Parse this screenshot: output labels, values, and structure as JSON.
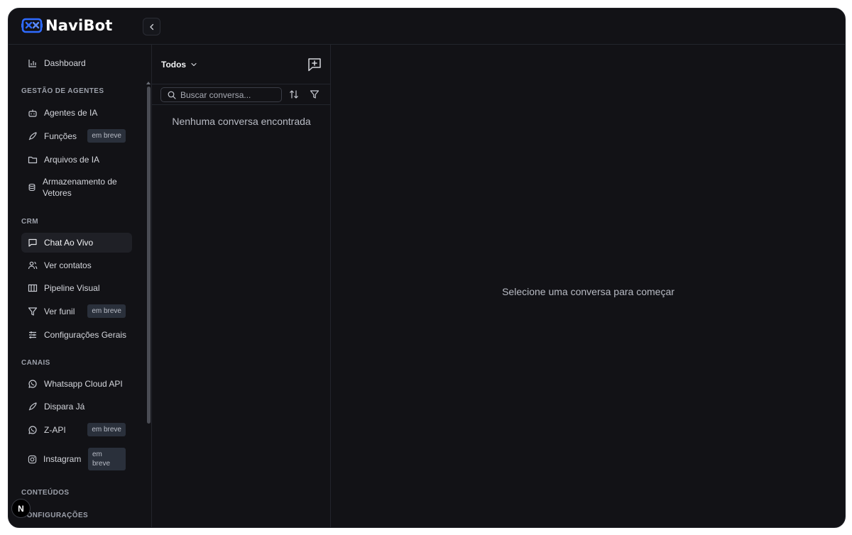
{
  "app": {
    "name": "NaviBot"
  },
  "sidebar": {
    "dashboard": "Dashboard",
    "sections": {
      "agents": "GESTÃO DE AGENTES",
      "crm": "CRM",
      "channels": "CANAIS",
      "contents": "CONTEÚDOS",
      "settings": "CONFIGURAÇÕES"
    },
    "items": {
      "ai_agents": "Agentes de IA",
      "functions": "Funções",
      "ai_files": "Arquivos de IA",
      "vector_storage": "Armazenamento de Vetores",
      "live_chat": "Chat Ao Vivo",
      "contacts": "Ver contatos",
      "pipeline": "Pipeline Visual",
      "funnel": "Ver funil",
      "general_settings": "Configurações Gerais",
      "whatsapp": "Whatsapp Cloud API",
      "dispara": "Dispara Já",
      "zapi": "Z-API",
      "instagram": "Instagram"
    },
    "badge_soon": "em breve",
    "active_item": "Chat Ao Vivo"
  },
  "conversations": {
    "filter_label": "Todos",
    "search_placeholder": "Buscar conversa...",
    "empty_text": "Nenhuma conversa encontrada"
  },
  "main": {
    "empty_text": "Selecione uma conversa para começar"
  },
  "footer": {
    "avatar_letter": "N"
  },
  "colors": {
    "background": "#121216",
    "border": "#23252c",
    "brand_blue": "#2f6bff",
    "badge_bg": "#2a303b"
  }
}
